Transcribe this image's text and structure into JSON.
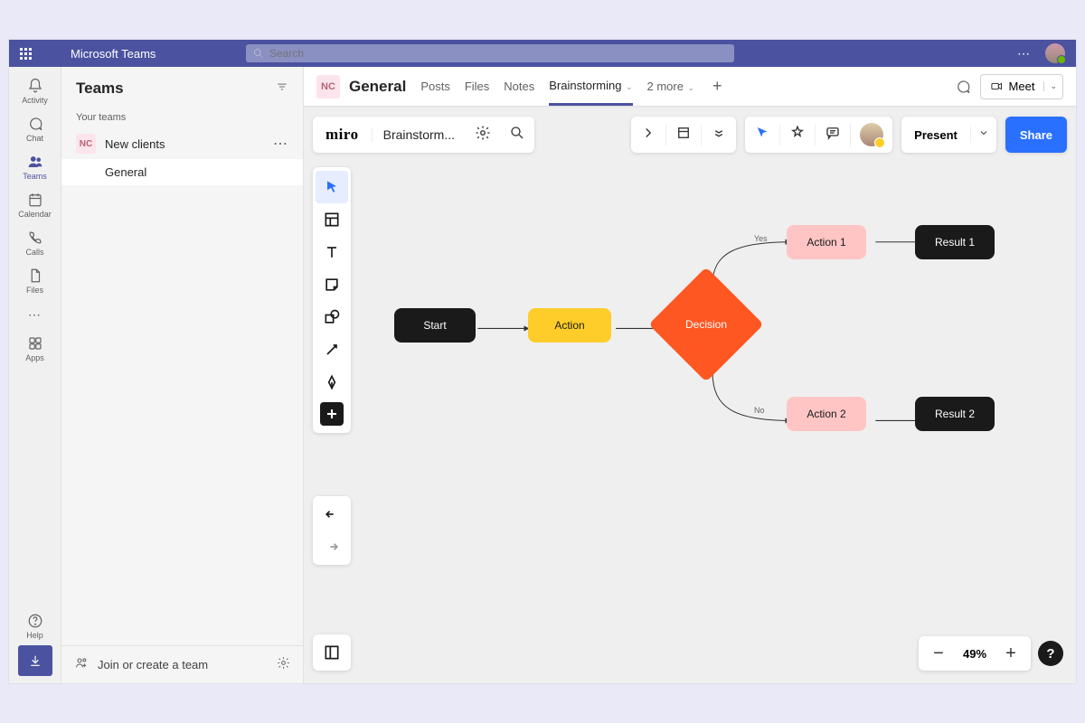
{
  "cmdbar": {
    "app_name": "Microsoft Teams",
    "search_placeholder": "Search"
  },
  "rail": {
    "items": [
      {
        "label": "Activity"
      },
      {
        "label": "Chat"
      },
      {
        "label": "Teams"
      },
      {
        "label": "Calendar"
      },
      {
        "label": "Calls"
      },
      {
        "label": "Files"
      }
    ],
    "apps_label": "Apps",
    "help_label": "Help"
  },
  "sidebar": {
    "title": "Teams",
    "group_label": "Your teams",
    "team": {
      "token": "NC",
      "name": "New clients"
    },
    "channel": "General",
    "footer_join": "Join or create a team"
  },
  "channel_header": {
    "token": "NC",
    "name": "General",
    "tabs": {
      "posts": "Posts",
      "files": "Files",
      "notes": "Notes",
      "brainstorming": "Brainstorming",
      "more": "2 more"
    },
    "meet_label": "Meet"
  },
  "miro": {
    "logo": "miro",
    "board_name": "Brainstorm...",
    "present_label": "Present",
    "share_label": "Share",
    "zoom": "49%",
    "help": "?",
    "flow": {
      "start": "Start",
      "action": "Action",
      "decision": "Decision",
      "yes": "Yes",
      "no": "No",
      "action1": "Action 1",
      "action2": "Action 2",
      "result1": "Result 1",
      "result2": "Result 2"
    }
  }
}
